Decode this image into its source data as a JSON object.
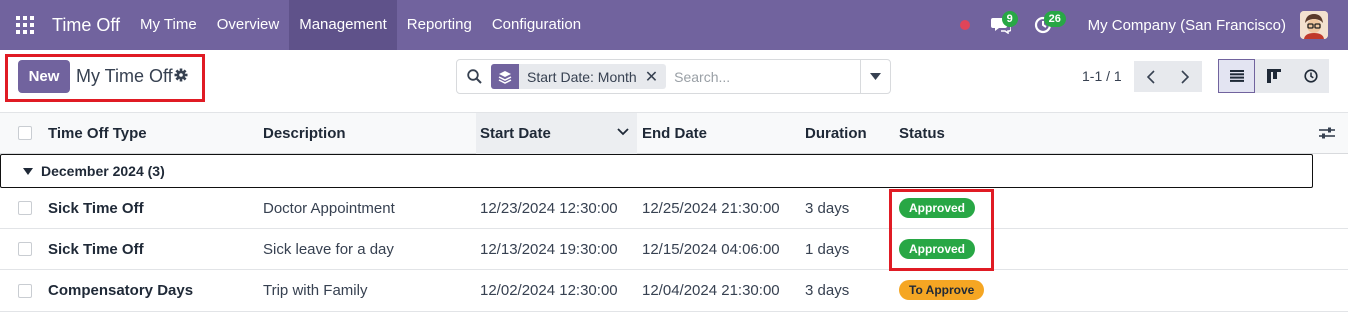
{
  "navbar": {
    "app_name": "Time Off",
    "menu": [
      {
        "label": "My Time"
      },
      {
        "label": "Overview"
      },
      {
        "label": "Management"
      },
      {
        "label": "Reporting"
      },
      {
        "label": "Configuration"
      }
    ],
    "active_menu": "Management",
    "messages_count": "9",
    "activities_count": "26",
    "company": "My Company (San Francisco)"
  },
  "control_panel": {
    "new_label": "New",
    "title": "My Time Off",
    "search": {
      "facet_label": "Start Date: Month",
      "placeholder": "Search..."
    },
    "pager": "1-1 / 1"
  },
  "table": {
    "columns": [
      "Time Off Type",
      "Description",
      "Start Date",
      "End Date",
      "Duration",
      "Status"
    ],
    "sorted_column": "Start Date",
    "group": {
      "label": "December 2024 (3)"
    },
    "rows": [
      {
        "type": "Sick Time Off",
        "description": "Doctor Appointment",
        "start": "12/23/2024 12:30:00",
        "end": "12/25/2024 21:30:00",
        "duration": "3 days",
        "status": "Approved"
      },
      {
        "type": "Sick Time Off",
        "description": "Sick leave for a day",
        "start": "12/13/2024 19:30:00",
        "end": "12/15/2024 04:06:00",
        "duration": "1 days",
        "status": "Approved"
      },
      {
        "type": "Compensatory Days",
        "description": "Trip with Family",
        "start": "12/02/2024 12:30:00",
        "end": "12/04/2024 21:30:00",
        "duration": "3 days",
        "status": "To Approve"
      }
    ]
  },
  "colors": {
    "brand": "#71639e",
    "approved": "#28a745",
    "to_approve": "#f5a623",
    "highlight": "#e01b24"
  }
}
